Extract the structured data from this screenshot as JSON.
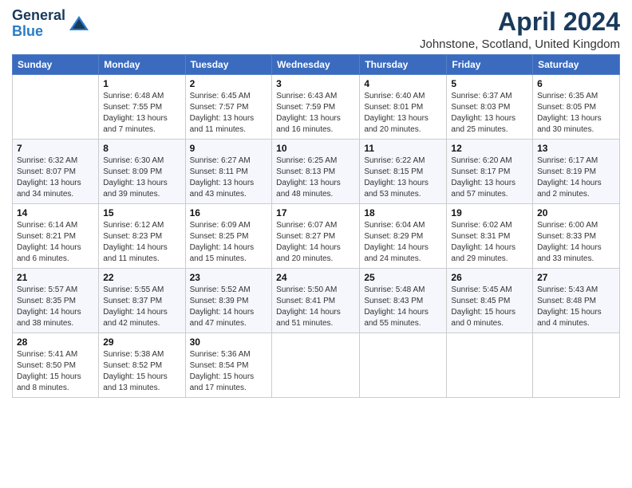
{
  "logo": {
    "line1": "General",
    "line2": "Blue"
  },
  "title": "April 2024",
  "subtitle": "Johnstone, Scotland, United Kingdom",
  "days_of_week": [
    "Sunday",
    "Monday",
    "Tuesday",
    "Wednesday",
    "Thursday",
    "Friday",
    "Saturday"
  ],
  "weeks": [
    [
      {
        "day": "",
        "sunrise": "",
        "sunset": "",
        "daylight": ""
      },
      {
        "day": "1",
        "sunrise": "Sunrise: 6:48 AM",
        "sunset": "Sunset: 7:55 PM",
        "daylight": "Daylight: 13 hours and 7 minutes."
      },
      {
        "day": "2",
        "sunrise": "Sunrise: 6:45 AM",
        "sunset": "Sunset: 7:57 PM",
        "daylight": "Daylight: 13 hours and 11 minutes."
      },
      {
        "day": "3",
        "sunrise": "Sunrise: 6:43 AM",
        "sunset": "Sunset: 7:59 PM",
        "daylight": "Daylight: 13 hours and 16 minutes."
      },
      {
        "day": "4",
        "sunrise": "Sunrise: 6:40 AM",
        "sunset": "Sunset: 8:01 PM",
        "daylight": "Daylight: 13 hours and 20 minutes."
      },
      {
        "day": "5",
        "sunrise": "Sunrise: 6:37 AM",
        "sunset": "Sunset: 8:03 PM",
        "daylight": "Daylight: 13 hours and 25 minutes."
      },
      {
        "day": "6",
        "sunrise": "Sunrise: 6:35 AM",
        "sunset": "Sunset: 8:05 PM",
        "daylight": "Daylight: 13 hours and 30 minutes."
      }
    ],
    [
      {
        "day": "7",
        "sunrise": "Sunrise: 6:32 AM",
        "sunset": "Sunset: 8:07 PM",
        "daylight": "Daylight: 13 hours and 34 minutes."
      },
      {
        "day": "8",
        "sunrise": "Sunrise: 6:30 AM",
        "sunset": "Sunset: 8:09 PM",
        "daylight": "Daylight: 13 hours and 39 minutes."
      },
      {
        "day": "9",
        "sunrise": "Sunrise: 6:27 AM",
        "sunset": "Sunset: 8:11 PM",
        "daylight": "Daylight: 13 hours and 43 minutes."
      },
      {
        "day": "10",
        "sunrise": "Sunrise: 6:25 AM",
        "sunset": "Sunset: 8:13 PM",
        "daylight": "Daylight: 13 hours and 48 minutes."
      },
      {
        "day": "11",
        "sunrise": "Sunrise: 6:22 AM",
        "sunset": "Sunset: 8:15 PM",
        "daylight": "Daylight: 13 hours and 53 minutes."
      },
      {
        "day": "12",
        "sunrise": "Sunrise: 6:20 AM",
        "sunset": "Sunset: 8:17 PM",
        "daylight": "Daylight: 13 hours and 57 minutes."
      },
      {
        "day": "13",
        "sunrise": "Sunrise: 6:17 AM",
        "sunset": "Sunset: 8:19 PM",
        "daylight": "Daylight: 14 hours and 2 minutes."
      }
    ],
    [
      {
        "day": "14",
        "sunrise": "Sunrise: 6:14 AM",
        "sunset": "Sunset: 8:21 PM",
        "daylight": "Daylight: 14 hours and 6 minutes."
      },
      {
        "day": "15",
        "sunrise": "Sunrise: 6:12 AM",
        "sunset": "Sunset: 8:23 PM",
        "daylight": "Daylight: 14 hours and 11 minutes."
      },
      {
        "day": "16",
        "sunrise": "Sunrise: 6:09 AM",
        "sunset": "Sunset: 8:25 PM",
        "daylight": "Daylight: 14 hours and 15 minutes."
      },
      {
        "day": "17",
        "sunrise": "Sunrise: 6:07 AM",
        "sunset": "Sunset: 8:27 PM",
        "daylight": "Daylight: 14 hours and 20 minutes."
      },
      {
        "day": "18",
        "sunrise": "Sunrise: 6:04 AM",
        "sunset": "Sunset: 8:29 PM",
        "daylight": "Daylight: 14 hours and 24 minutes."
      },
      {
        "day": "19",
        "sunrise": "Sunrise: 6:02 AM",
        "sunset": "Sunset: 8:31 PM",
        "daylight": "Daylight: 14 hours and 29 minutes."
      },
      {
        "day": "20",
        "sunrise": "Sunrise: 6:00 AM",
        "sunset": "Sunset: 8:33 PM",
        "daylight": "Daylight: 14 hours and 33 minutes."
      }
    ],
    [
      {
        "day": "21",
        "sunrise": "Sunrise: 5:57 AM",
        "sunset": "Sunset: 8:35 PM",
        "daylight": "Daylight: 14 hours and 38 minutes."
      },
      {
        "day": "22",
        "sunrise": "Sunrise: 5:55 AM",
        "sunset": "Sunset: 8:37 PM",
        "daylight": "Daylight: 14 hours and 42 minutes."
      },
      {
        "day": "23",
        "sunrise": "Sunrise: 5:52 AM",
        "sunset": "Sunset: 8:39 PM",
        "daylight": "Daylight: 14 hours and 47 minutes."
      },
      {
        "day": "24",
        "sunrise": "Sunrise: 5:50 AM",
        "sunset": "Sunset: 8:41 PM",
        "daylight": "Daylight: 14 hours and 51 minutes."
      },
      {
        "day": "25",
        "sunrise": "Sunrise: 5:48 AM",
        "sunset": "Sunset: 8:43 PM",
        "daylight": "Daylight: 14 hours and 55 minutes."
      },
      {
        "day": "26",
        "sunrise": "Sunrise: 5:45 AM",
        "sunset": "Sunset: 8:45 PM",
        "daylight": "Daylight: 15 hours and 0 minutes."
      },
      {
        "day": "27",
        "sunrise": "Sunrise: 5:43 AM",
        "sunset": "Sunset: 8:48 PM",
        "daylight": "Daylight: 15 hours and 4 minutes."
      }
    ],
    [
      {
        "day": "28",
        "sunrise": "Sunrise: 5:41 AM",
        "sunset": "Sunset: 8:50 PM",
        "daylight": "Daylight: 15 hours and 8 minutes."
      },
      {
        "day": "29",
        "sunrise": "Sunrise: 5:38 AM",
        "sunset": "Sunset: 8:52 PM",
        "daylight": "Daylight: 15 hours and 13 minutes."
      },
      {
        "day": "30",
        "sunrise": "Sunrise: 5:36 AM",
        "sunset": "Sunset: 8:54 PM",
        "daylight": "Daylight: 15 hours and 17 minutes."
      },
      {
        "day": "",
        "sunrise": "",
        "sunset": "",
        "daylight": ""
      },
      {
        "day": "",
        "sunrise": "",
        "sunset": "",
        "daylight": ""
      },
      {
        "day": "",
        "sunrise": "",
        "sunset": "",
        "daylight": ""
      },
      {
        "day": "",
        "sunrise": "",
        "sunset": "",
        "daylight": ""
      }
    ]
  ]
}
